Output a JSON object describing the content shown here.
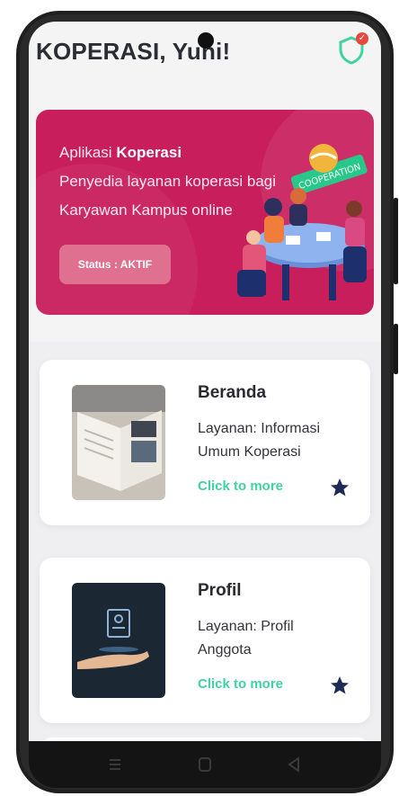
{
  "header": {
    "title": "KOPERASI, Yuni!",
    "shield_icon": "shield-check-icon",
    "badge_icon": "check-badge-icon"
  },
  "banner": {
    "line1_prefix": "Aplikasi ",
    "line1_bold": "Koperasi",
    "line2": "Penyedia layanan koperasi bagi",
    "line3": "Karyawan Kampus online",
    "status_label": "Status : AKTIF",
    "illustration_text": "COOPERATION",
    "bg_color": "#c81e5b"
  },
  "cards": [
    {
      "title": "Beranda",
      "desc_line1": "Layanan: Informasi",
      "desc_line2": "Umum Koperasi",
      "link": "Click to more",
      "thumb_icon": "open-book-image",
      "action_icon": "star-icon"
    },
    {
      "title": "Profil",
      "desc_line1": "Layanan: Profil",
      "desc_line2": "Anggota",
      "link": "Click to more",
      "thumb_icon": "hand-profile-image",
      "action_icon": "star-icon"
    }
  ],
  "navbar": {
    "icons": [
      "menu-icon",
      "home-icon",
      "back-icon"
    ]
  },
  "colors": {
    "accent": "#3fd3a1",
    "brand": "#c81e5b",
    "star": "#1d2a55"
  }
}
